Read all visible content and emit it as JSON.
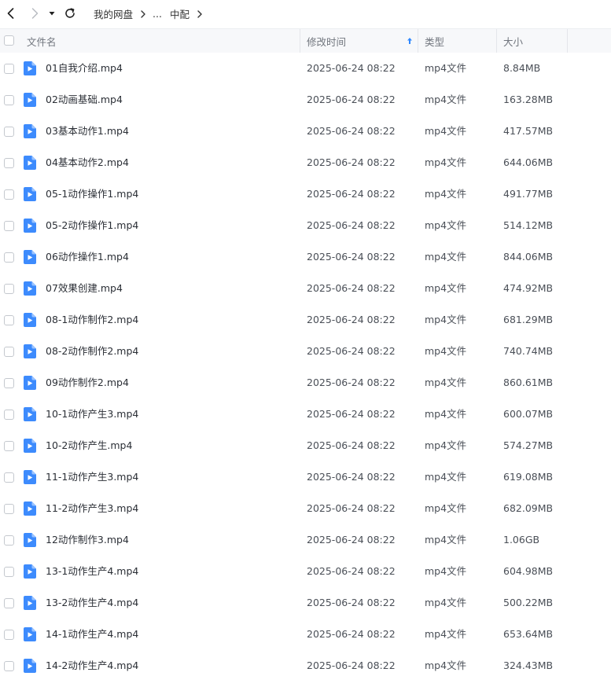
{
  "breadcrumb": {
    "root": "我的网盘",
    "ellipsis": "...",
    "current": "中配"
  },
  "icons": {
    "back": "chevron-left-icon",
    "forward": "chevron-right-icon",
    "history": "caret-down-icon",
    "refresh": "refresh-icon",
    "file": "video-file-icon"
  },
  "colors": {
    "file_icon": "#3d8bfd",
    "sort_arrow": "#2f88ff",
    "header_bg": "#f7f8fa"
  },
  "table": {
    "columns": {
      "name": "文件名",
      "modified": "修改时间",
      "type": "类型",
      "size": "大小"
    },
    "sort": {
      "column": "modified",
      "direction": "ascending"
    },
    "rows": [
      {
        "name": "01自我介绍.mp4",
        "modified": "2025-06-24 08:22",
        "type": "mp4文件",
        "size": "8.84MB"
      },
      {
        "name": "02动画基础.mp4",
        "modified": "2025-06-24 08:22",
        "type": "mp4文件",
        "size": "163.28MB"
      },
      {
        "name": "03基本动作1.mp4",
        "modified": "2025-06-24 08:22",
        "type": "mp4文件",
        "size": "417.57MB"
      },
      {
        "name": "04基本动作2.mp4",
        "modified": "2025-06-24 08:22",
        "type": "mp4文件",
        "size": "644.06MB"
      },
      {
        "name": "05-1动作操作1.mp4",
        "modified": "2025-06-24 08:22",
        "type": "mp4文件",
        "size": "491.77MB"
      },
      {
        "name": "05-2动作操作1.mp4",
        "modified": "2025-06-24 08:22",
        "type": "mp4文件",
        "size": "514.12MB"
      },
      {
        "name": "06动作操作1.mp4",
        "modified": "2025-06-24 08:22",
        "type": "mp4文件",
        "size": "844.06MB"
      },
      {
        "name": "07效果创建.mp4",
        "modified": "2025-06-24 08:22",
        "type": "mp4文件",
        "size": "474.92MB"
      },
      {
        "name": "08-1动作制作2.mp4",
        "modified": "2025-06-24 08:22",
        "type": "mp4文件",
        "size": "681.29MB"
      },
      {
        "name": "08-2动作制作2.mp4",
        "modified": "2025-06-24 08:22",
        "type": "mp4文件",
        "size": "740.74MB"
      },
      {
        "name": "09动作制作2.mp4",
        "modified": "2025-06-24 08:22",
        "type": "mp4文件",
        "size": "860.61MB"
      },
      {
        "name": "10-1动作产生3.mp4",
        "modified": "2025-06-24 08:22",
        "type": "mp4文件",
        "size": "600.07MB"
      },
      {
        "name": "10-2动作产生.mp4",
        "modified": "2025-06-24 08:22",
        "type": "mp4文件",
        "size": "574.27MB"
      },
      {
        "name": "11-1动作产生3.mp4",
        "modified": "2025-06-24 08:22",
        "type": "mp4文件",
        "size": "619.08MB"
      },
      {
        "name": "11-2动作产生3.mp4",
        "modified": "2025-06-24 08:22",
        "type": "mp4文件",
        "size": "682.09MB"
      },
      {
        "name": "12动作制作3.mp4",
        "modified": "2025-06-24 08:22",
        "type": "mp4文件",
        "size": "1.06GB"
      },
      {
        "name": "13-1动作生产4.mp4",
        "modified": "2025-06-24 08:22",
        "type": "mp4文件",
        "size": "604.98MB"
      },
      {
        "name": "13-2动作生产4.mp4",
        "modified": "2025-06-24 08:22",
        "type": "mp4文件",
        "size": "500.22MB"
      },
      {
        "name": "14-1动作生产4.mp4",
        "modified": "2025-06-24 08:22",
        "type": "mp4文件",
        "size": "653.64MB"
      },
      {
        "name": "14-2动作生产4.mp4",
        "modified": "2025-06-24 08:22",
        "type": "mp4文件",
        "size": "324.43MB"
      }
    ]
  }
}
